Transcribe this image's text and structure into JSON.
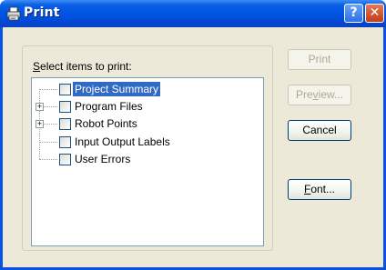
{
  "window": {
    "title": "Print",
    "help_label": "?",
    "close_label": "✕"
  },
  "icons": {
    "title": "printer-icon",
    "help": "help-icon",
    "close": "close-icon",
    "expand": "plus-icon"
  },
  "colors": {
    "titlebar": "#0054e3",
    "face": "#ece9d8",
    "selection": "#316ac5",
    "close": "#c33c17"
  },
  "group": {
    "label_prefix": "S",
    "label_rest": "elect items to print:"
  },
  "tree": {
    "expander_symbol": "+",
    "items": [
      {
        "label": "Project Summary",
        "selected": true,
        "expandable": false,
        "checked": false
      },
      {
        "label": "Program Files",
        "selected": false,
        "expandable": true,
        "checked": false
      },
      {
        "label": "Robot Points",
        "selected": false,
        "expandable": true,
        "checked": false
      },
      {
        "label": "Input Output Labels",
        "selected": false,
        "expandable": false,
        "checked": false
      },
      {
        "label": "User Errors",
        "selected": false,
        "expandable": false,
        "checked": false
      }
    ]
  },
  "buttons": {
    "print": {
      "label": "Print",
      "enabled": false
    },
    "preview": {
      "label_before": "Pre",
      "label_mnemonic": "v",
      "label_after": "iew...",
      "enabled": false
    },
    "cancel": {
      "label": "Cancel",
      "enabled": true
    },
    "font": {
      "label_mnemonic": "F",
      "label_after": "ont...",
      "enabled": true
    }
  }
}
